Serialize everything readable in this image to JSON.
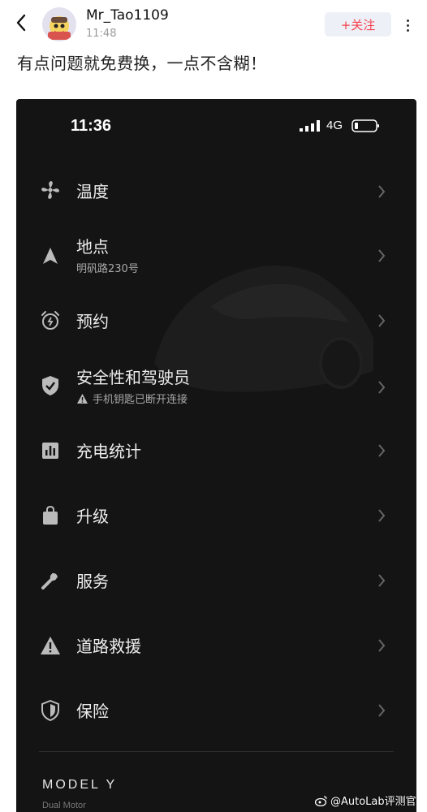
{
  "header": {
    "username": "Mr_Tao1109",
    "time": "11:48",
    "follow_label": "+关注"
  },
  "post": {
    "text": "有点问题就免费换，一点不含糊！"
  },
  "phone": {
    "status": {
      "time": "11:36",
      "network": "4G"
    },
    "menu": [
      {
        "label": "温度",
        "icon": "fan-icon"
      },
      {
        "label": "地点",
        "sub": "明矾路230号",
        "icon": "location-arrow-icon"
      },
      {
        "label": "预约",
        "icon": "alarm-clock-icon"
      },
      {
        "label": "安全性和驾驶员",
        "sub": "手机钥匙已断开连接",
        "sub_icon": "warning-icon",
        "icon": "shield-check-icon"
      },
      {
        "label": "充电统计",
        "icon": "bar-chart-icon"
      },
      {
        "label": "升级",
        "icon": "shopping-bag-icon"
      },
      {
        "label": "服务",
        "icon": "wrench-icon"
      },
      {
        "label": "道路救援",
        "icon": "warning-triangle-icon"
      },
      {
        "label": "保险",
        "icon": "shield-icon"
      }
    ],
    "model": "MODEL Y",
    "model_extra": "Dual Motor"
  },
  "watermark": "@AutoLab评测官",
  "colors": {
    "follow_text": "#f5414d",
    "phone_bg": "#141414",
    "menu_text": "#ececec"
  }
}
